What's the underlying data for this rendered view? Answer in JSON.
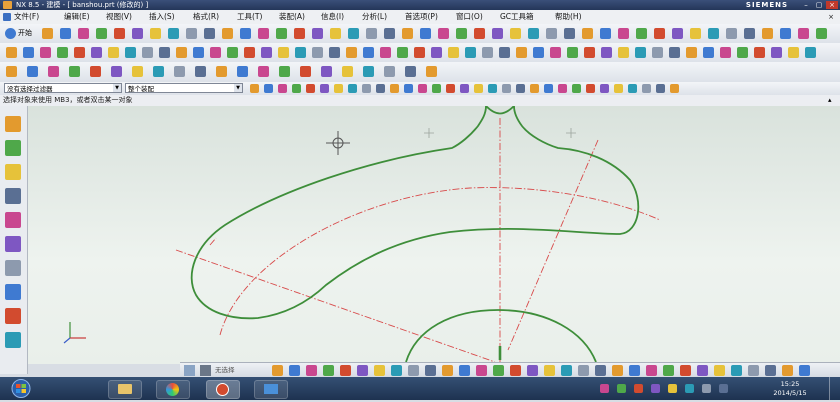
{
  "window": {
    "title": "NX 8.5 - 建模 - [ banshou.prt (修改的) ]",
    "brand": "SIEMENS",
    "controls": [
      "–",
      "▢",
      "×"
    ]
  },
  "menu": [
    "文件(F)",
    "编辑(E)",
    "视图(V)",
    "插入(S)",
    "格式(R)",
    "工具(T)",
    "装配(A)",
    "信息(I)",
    "分析(L)",
    "首选项(P)",
    "窗口(O)",
    "GC工具箱",
    "帮助(H)"
  ],
  "toolbar_row1": {
    "start_label": "开始",
    "icon_count": 44
  },
  "toolbar_row2": {
    "icon_count": 50
  },
  "toolbar_row3": {
    "filter_combo": "没有选择过滤器",
    "scope_combo": "整个装配"
  },
  "status_message": "选择对象来使用 MB3，或者双击某一对象",
  "colors": {
    "curve": "#3e8e3a",
    "centerline": "#d84a4a",
    "canvas_top": "#d9e2dc",
    "taskbar": "#243a5a"
  },
  "resource_bar": {
    "icons": [
      "assembly-navigator-icon",
      "constraint-navigator-icon",
      "part-navigator-icon",
      "reuse-library-icon",
      "web-browser-icon",
      "history-icon",
      "system-materials-icon",
      "process-studio-icon",
      "roles-icon",
      "system-scenes-icon"
    ]
  },
  "snap_toolbar": {
    "label": "无选择"
  },
  "taskbar": {
    "time": "15:25",
    "date": "2014/5/15"
  }
}
